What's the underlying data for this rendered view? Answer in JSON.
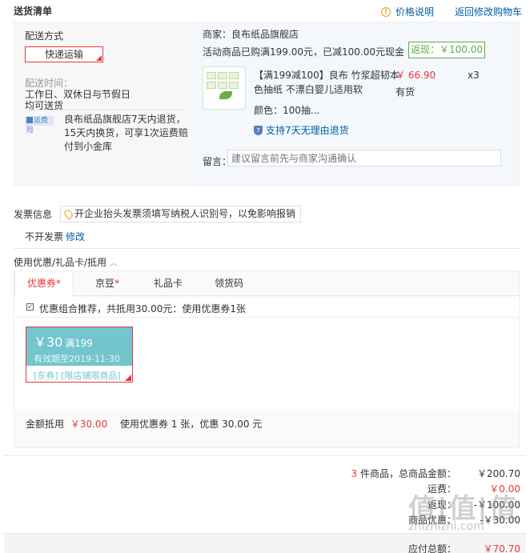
{
  "header": {
    "title": "送货清单",
    "price_note": "价格说明",
    "back_to_cart": "返回修改购物车"
  },
  "shipping": {
    "method_label": "配送方式",
    "method_value": "快递运输",
    "time_label": "配送时间：",
    "time_line1": "工作日、双休日与节假日",
    "time_line2": "均可送货",
    "shop_badge": "运费险",
    "shop_policy": "良布纸品旗舰店7天内退货，15天内换货，可享1次运费赔付到小金库"
  },
  "merchant": {
    "name": "商家：良布纸品旗舰店",
    "promo": "活动商品已购满199.00元，已减100.00元现金",
    "rebate": "返现：￥100.00"
  },
  "product": {
    "name": "【满199减100】良布 竹浆超韧本色抽纸 不漂白婴儿适用软",
    "price": "￥ 66.90",
    "qty": "x3",
    "stock": "有货",
    "color": "颜色：100抽...",
    "return_policy": "支持7天无理由退货"
  },
  "remark": {
    "label": "留言：",
    "placeholder": "建议留言前先与商家沟通确认"
  },
  "invoice": {
    "title": "发票信息",
    "tip": "开企业抬头发票须填写纳税人识别号，以免影响报销",
    "value": "不开发票",
    "edit": "修改"
  },
  "coupons": {
    "title": "使用优惠/礼品卡/抵用",
    "tabs": [
      {
        "label": "优惠券",
        "star": "*"
      },
      {
        "label": "京豆",
        "star": "*"
      },
      {
        "label": "礼品卡",
        "star": ""
      },
      {
        "label": "领货码",
        "star": ""
      }
    ],
    "combo_text": "优惠组合推荐，共抵用30.00元：使用优惠券1张",
    "card": {
      "amount": "￥30",
      "condition": "满199",
      "valid": "有效期至2019-11-30",
      "tag": "[东券] [限店铺限商品]"
    },
    "sum_label": "金额抵用",
    "sum_value": "￥30.00",
    "sum_detail": "使用优惠券 1 张，优惠 30.00 元"
  },
  "totals": {
    "count": "3",
    "count_label": "件商品，总商品金额：",
    "goods_total": "￥200.70",
    "shipping_label": "运费：",
    "shipping_value": "￥0.00",
    "rebate_label": "返现：",
    "rebate_value": "-￥100.00",
    "discount_label": "商品优惠：",
    "discount_value": "-￥30.00",
    "payable_label": "应付总额：",
    "payable_value": "￥70.70"
  },
  "watermark": {
    "main": "值|值|值",
    "sub": "zhizhizhi.com"
  },
  "colors": {
    "accent": "#e4393c",
    "link": "#005ea7",
    "rebate_green": "#5dab4d",
    "coupon_teal": "#74c5cd"
  }
}
